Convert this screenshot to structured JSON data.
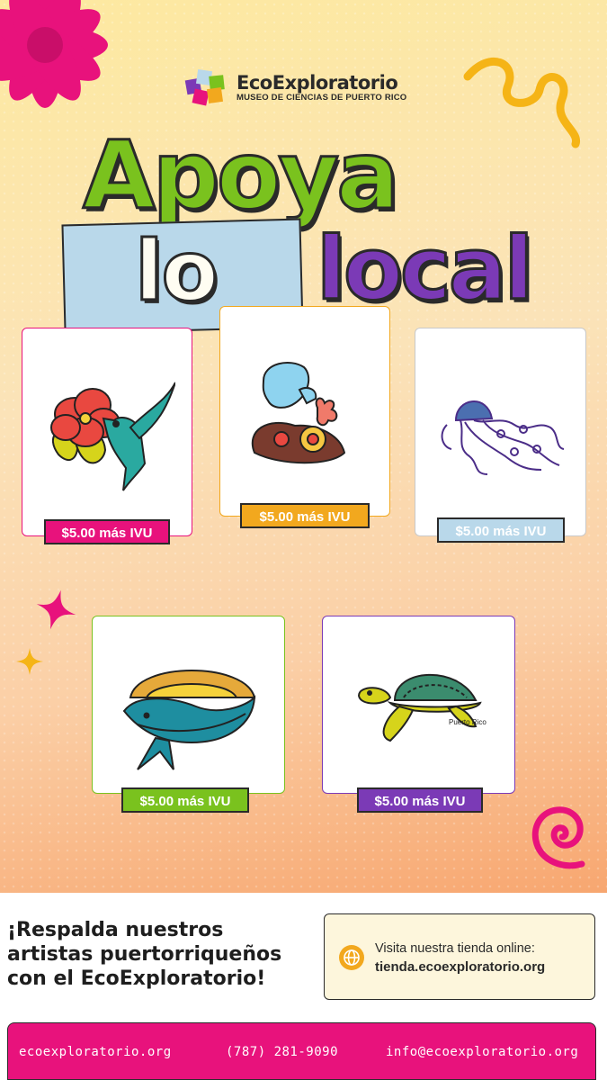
{
  "logo": {
    "title": "EcoExploratorio",
    "subtitle": "MUSEO DE CIENCIAS DE PUERTO RICO"
  },
  "headline": {
    "line1": "Apoya",
    "line2a": "lo",
    "line2b": "local"
  },
  "products": [
    {
      "name": "hummingbird-hibiscus-sticker",
      "price": "$5.00 más IVU",
      "color": "#e8127c"
    },
    {
      "name": "manatee-coral-sticker",
      "price": "$5.00 más IVU",
      "color": "#f2a81e"
    },
    {
      "name": "jellyfish-sticker",
      "price": "$5.00 más IVU",
      "color": "#b9d8ea"
    },
    {
      "name": "whale-sun-sticker",
      "price": "$5.00 más IVU",
      "color": "#7ac21e"
    },
    {
      "name": "sea-turtle-sticker",
      "price": "$5.00 más IVU",
      "color": "#7b3ab6"
    }
  ],
  "sticker_texts": {
    "turtle": "Puerto Rico"
  },
  "tagline": "¡Respalda nuestros artistas puertorriqueños con el EcoExploratorio!",
  "store": {
    "line1": "Visita nuestra tienda online:",
    "line2": "tienda.ecoexploratorio.org"
  },
  "contact": {
    "website": "ecoexploratorio.org",
    "phone": "(787) 281-9090",
    "email": "info@ecoexploratorio.org"
  },
  "colors": {
    "pink": "#e8127c",
    "orange": "#f2a81e",
    "lightblue": "#b9d8ea",
    "green": "#7ac21e",
    "purple": "#7b3ab6"
  }
}
